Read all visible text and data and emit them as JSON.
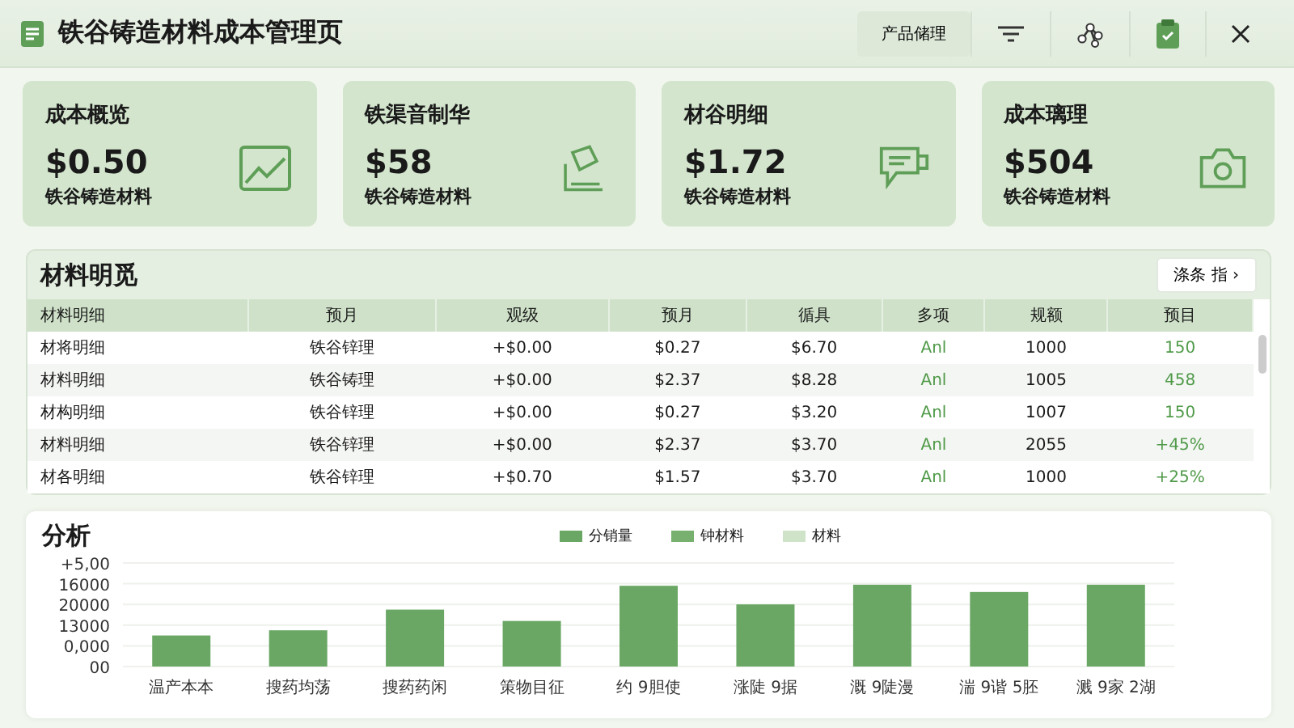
{
  "header": {
    "title": "铁谷铸造材料成本管理页",
    "toolbar": [
      {
        "kind": "text",
        "label": "产品储理"
      },
      {
        "kind": "filter"
      },
      {
        "kind": "share"
      },
      {
        "kind": "clipboard"
      },
      {
        "kind": "close"
      }
    ]
  },
  "cards": [
    {
      "title": "成本概览",
      "value": "$0.50",
      "caption": "铁谷铸造材料",
      "kind": "chart"
    },
    {
      "title": "铁渠音制华",
      "value": "$58",
      "caption": "铁谷铸造材料",
      "kind": "document"
    },
    {
      "title": "材谷明细",
      "value": "$1.72",
      "caption": "铁谷铸造材料",
      "kind": "message"
    },
    {
      "title": "成本璃理",
      "value": "$504",
      "caption": "铁谷铸造材料",
      "kind": "camera"
    }
  ],
  "table": {
    "title": "材料明觅",
    "button": "涤条 指 ›",
    "columns": [
      "材料明细",
      "预月",
      "观级",
      "预月",
      "循具",
      "多项",
      "规额",
      "预目"
    ],
    "rows": [
      [
        "材将明细",
        "铁谷锌理",
        "+$0.00",
        "$0.27",
        "$6.70",
        "Anl",
        "1000",
        "150"
      ],
      [
        "材料明细",
        "铁谷铸理",
        "+$0.00",
        "$2.37",
        "$8.28",
        "Anl",
        "1005",
        "458"
      ],
      [
        "材构明细",
        "铁谷锌理",
        "+$0.00",
        "$0.27",
        "$3.20",
        "Anl",
        "1007",
        "150"
      ],
      [
        "材料明细",
        "铁谷锌理",
        "+$0.00",
        "$2.37",
        "$3.70",
        "Anl",
        "2055",
        "+45%"
      ],
      [
        "材各明细",
        "铁谷锌理",
        "+$0.70",
        "$1.57",
        "$3.70",
        "Anl",
        "1000",
        "+25%"
      ]
    ]
  },
  "analysis": {
    "title": "分析",
    "legend": [
      {
        "label": "分销量",
        "color": "#6aa764"
      },
      {
        "label": "钟材料",
        "color": "#78b06f"
      },
      {
        "label": "材料",
        "color": "#cfe3c9"
      }
    ],
    "y_labels": [
      "+5,00",
      "16000",
      "20000",
      "13000",
      "0,000",
      "00"
    ],
    "categories": [
      "温产本本",
      "搜药均荡",
      "搜药药闲",
      "策物目征",
      "约 9胆使",
      "涨陡 9据",
      "溉 9陡漫",
      "湍 9谐 5胚",
      "溅 9家 2湖"
    ]
  }
}
